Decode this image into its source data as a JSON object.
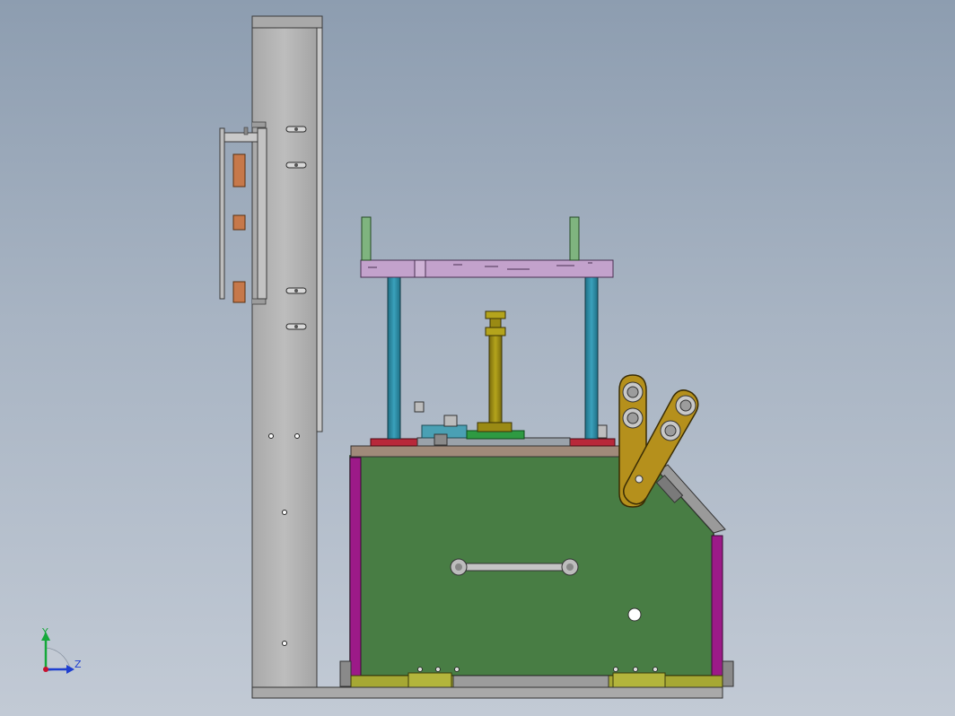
{
  "view": {
    "title": "",
    "background_top": "#8d9db0",
    "background_bottom": "#c2cad5"
  },
  "triad": {
    "y_label": "Y",
    "z_label": "Z",
    "y_color": "#15a83a",
    "z_color": "#1f3fd0",
    "origin_color": "#c8102e"
  },
  "colors": {
    "column": "#b3b3b3",
    "outline": "#3a3a3a",
    "base_body": "#487d44",
    "side_panel": "#9c1a88",
    "top_plate": "#a08a7a",
    "top_beam": "#c3a2cc",
    "pillar": "#2a8aa4",
    "pillar_cap": "#7fb47f",
    "screw": "#9a8a14",
    "roller_arm": "#b5901c",
    "feet": "#a6a834",
    "pad": "#c6784a"
  }
}
